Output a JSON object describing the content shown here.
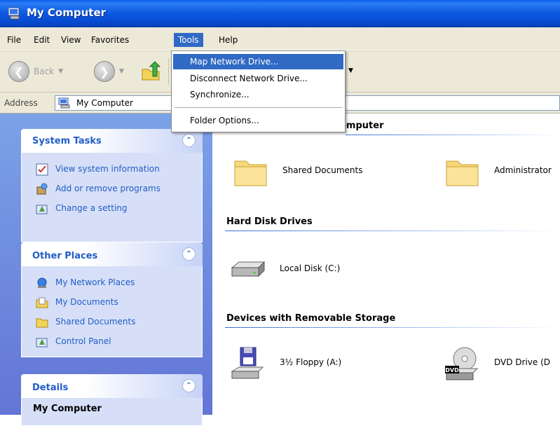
{
  "window": {
    "title": "My Computer"
  },
  "menubar": {
    "items": [
      "File",
      "Edit",
      "View",
      "Favorites",
      "Tools",
      "Help"
    ],
    "active": "Tools"
  },
  "toolbar": {
    "back_label": "Back"
  },
  "address": {
    "label": "Address",
    "value": "My Computer"
  },
  "tools_menu": {
    "items": [
      "Map Network Drive...",
      "Disconnect Network Drive...",
      "Synchronize...",
      "Folder Options..."
    ],
    "highlighted": "Map Network Drive..."
  },
  "system_tasks": {
    "title": "System Tasks",
    "items": [
      {
        "label": "View system information",
        "icon": "system-info-icon"
      },
      {
        "label": "Add or remove programs",
        "icon": "add-remove-programs-icon"
      },
      {
        "label": "Change a setting",
        "icon": "control-panel-icon"
      }
    ]
  },
  "other_places": {
    "title": "Other Places",
    "items": [
      {
        "label": "My Network Places",
        "icon": "network-places-icon"
      },
      {
        "label": "My Documents",
        "icon": "my-documents-icon"
      },
      {
        "label": "Shared Documents",
        "icon": "folder-icon"
      },
      {
        "label": "Control Panel",
        "icon": "control-panel-icon"
      }
    ]
  },
  "details": {
    "title": "Details",
    "subtitle": "My Computer"
  },
  "content": {
    "header_partial": "omputer",
    "files_stored": [
      {
        "label": "Shared Documents",
        "icon": "folder-icon"
      },
      {
        "label": "Administrator",
        "icon": "folder-icon"
      }
    ],
    "hard_disk_drives": {
      "title": "Hard Disk Drives",
      "items": [
        {
          "label": "Local Disk (C:)",
          "icon": "hard-disk-icon"
        }
      ]
    },
    "removable": {
      "title": "Devices with Removable Storage",
      "items": [
        {
          "label": "3½ Floppy (A:)",
          "icon": "floppy-drive-icon"
        },
        {
          "label": "DVD Drive (D",
          "icon": "dvd-drive-icon"
        }
      ],
      "dvd_badge": "DVD"
    }
  },
  "colors": {
    "title_bar": "#0a5fe8",
    "menu_highlight": "#316ac5",
    "link": "#215dc6",
    "task_pane": "#7ba2e7"
  }
}
